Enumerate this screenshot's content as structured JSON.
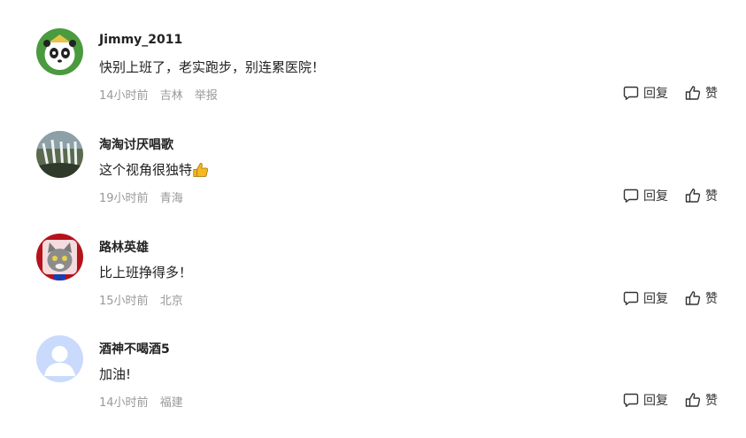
{
  "comments": [
    {
      "username": "Jimmy_2011",
      "content": "快别上班了，老实跑步，别连累医院！",
      "time": "14小时前",
      "location": "吉林",
      "report": "举报",
      "reply_label": "回复",
      "like_label": "赞"
    },
    {
      "username": "淘淘讨厌唱歌",
      "content": "这个视角很独特",
      "time": "19小时前",
      "location": "青海",
      "reply_label": "回复",
      "like_label": "赞"
    },
    {
      "username": "路林英雄",
      "content": "比上班挣得多！",
      "time": "15小时前",
      "location": "北京",
      "reply_label": "回复",
      "like_label": "赞"
    },
    {
      "username": "酒神不喝酒5",
      "content": "加油!",
      "time": "14小时前",
      "location": "福建",
      "reply_label": "回复",
      "like_label": "赞"
    }
  ],
  "icons": {
    "reply": "comment-bubble-icon",
    "like": "thumbs-up-icon",
    "emoji": "thumbs-up-emoji"
  },
  "colors": {
    "meta_text": "#999999",
    "text": "#222222",
    "emoji": "#f5b820"
  }
}
